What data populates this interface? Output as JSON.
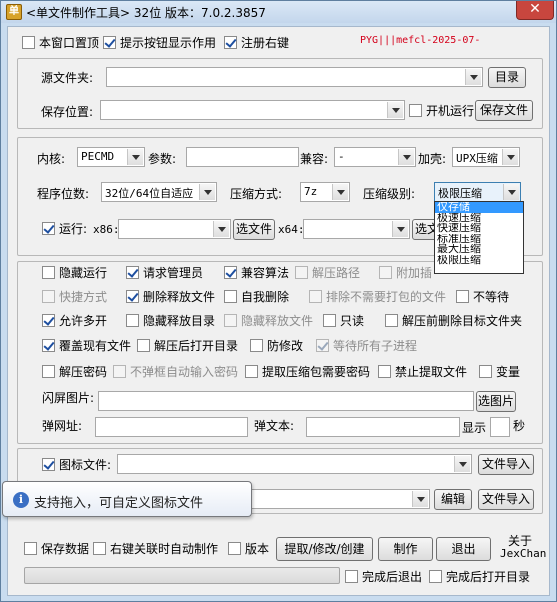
{
  "window": {
    "title": "<单文件制作工具> 32位  版本：7.0.2.3857",
    "app_icon_glyph": "单",
    "close_glyph": "✕"
  },
  "top_options": {
    "stay_on_top": {
      "label": "本窗口置顶",
      "checked": false
    },
    "show_tips": {
      "label": "提示按钮显示作用",
      "checked": true
    },
    "register_right_click": {
      "label": "注册右键",
      "checked": true
    },
    "reg_text": "PYG|||mefcl-2025-07-"
  },
  "source": {
    "source_label": "源文件夹:",
    "browse_label": "目录",
    "save_label": "保存位置:",
    "startup_label": "开机运行",
    "startup_checked": false,
    "save_file_label": "保存文件"
  },
  "settings": {
    "kernel_label": "内核:",
    "kernel_value": "PECMD",
    "params_label": "参数:",
    "compat_label": "兼容:",
    "compat_value": "-",
    "shell_label": "加壳:",
    "shell_value": "UPX压缩",
    "arch_label": "程序位数:",
    "arch_value": "32位/64位自适应",
    "compress_method_label": "压缩方式:",
    "compress_method_value": "7z",
    "compress_level_label": "压缩级别:",
    "compress_level_value": "极限压缩",
    "level_options": [
      "仅存储",
      "极速压缩",
      "快速压缩",
      "标准压缩",
      "最大压缩",
      "极限压缩"
    ],
    "run_label": "运行:",
    "run_checked": true,
    "x86_label": "x86:",
    "x86_browse": "选文件",
    "x64_label": "x64:",
    "x64_browse": "选文"
  },
  "options": {
    "row1": [
      {
        "label": "隐藏运行",
        "checked": false,
        "disabled": false
      },
      {
        "label": "请求管理员",
        "checked": true,
        "disabled": false
      },
      {
        "label": "兼容算法",
        "checked": true,
        "disabled": false
      },
      {
        "label": "解压路径",
        "checked": false,
        "disabled": true
      },
      {
        "label": "附加插",
        "checked": false,
        "disabled": true
      }
    ],
    "row2": [
      {
        "label": "快捷方式",
        "checked": false,
        "disabled": true
      },
      {
        "label": "删除释放文件",
        "checked": true,
        "disabled": false
      },
      {
        "label": "自我删除",
        "checked": false,
        "disabled": false
      },
      {
        "label": "排除不需要打包的文件",
        "checked": false,
        "disabled": true
      },
      {
        "label": "不等待",
        "checked": false,
        "disabled": false
      }
    ],
    "row3": [
      {
        "label": "允许多开",
        "checked": true,
        "disabled": false
      },
      {
        "label": "隐藏释放目录",
        "checked": false,
        "disabled": false
      },
      {
        "label": "隐藏释放文件",
        "checked": false,
        "disabled": true
      },
      {
        "label": "只读",
        "checked": false,
        "disabled": false
      },
      {
        "label": "解压前删除目标文件夹",
        "checked": false,
        "disabled": false
      }
    ],
    "row4": [
      {
        "label": "覆盖现有文件",
        "checked": true,
        "disabled": false
      },
      {
        "label": "解压后打开目录",
        "checked": false,
        "disabled": false
      },
      {
        "label": "防修改",
        "checked": false,
        "disabled": false
      },
      {
        "label": "等待所有子进程",
        "checked": true,
        "disabled": true
      }
    ],
    "row5": [
      {
        "label": "解压密码",
        "checked": false,
        "disabled": false
      },
      {
        "label": "不弹框自动输入密码",
        "checked": false,
        "disabled": true
      },
      {
        "label": "提取压缩包需要密码",
        "checked": false,
        "disabled": false
      },
      {
        "label": "禁止提取文件",
        "checked": false,
        "disabled": false
      },
      {
        "label": "变量",
        "checked": false,
        "disabled": false
      }
    ]
  },
  "splash": {
    "image_label": "闪屏图片:",
    "image_button": "选图片",
    "url_label": "弹网址:",
    "text_label": "弹文本:",
    "show_label": "显示",
    "seconds_label": "秒"
  },
  "icon": {
    "label": "图标文件:",
    "checked": true,
    "import_label": "文件导入",
    "edit_label": "编辑",
    "import2_label": "文件导入"
  },
  "tooltip": {
    "icon_glyph": "i",
    "text": "支持拖入，可自定义图标文件"
  },
  "bottom": {
    "save_data": {
      "label": "保存数据",
      "checked": false
    },
    "right_click_make": {
      "label": "右键关联时自动制作",
      "checked": false
    },
    "version": {
      "label": "版本",
      "checked": false
    },
    "extract_button": "提取/修改/创建",
    "make_button": "制作",
    "exit_button": "退出",
    "about_label": "关于",
    "author_label": "JexChan",
    "exit_after": {
      "label": "完成后退出",
      "checked": false
    },
    "open_after": {
      "label": "完成后打开目录",
      "checked": false
    }
  }
}
